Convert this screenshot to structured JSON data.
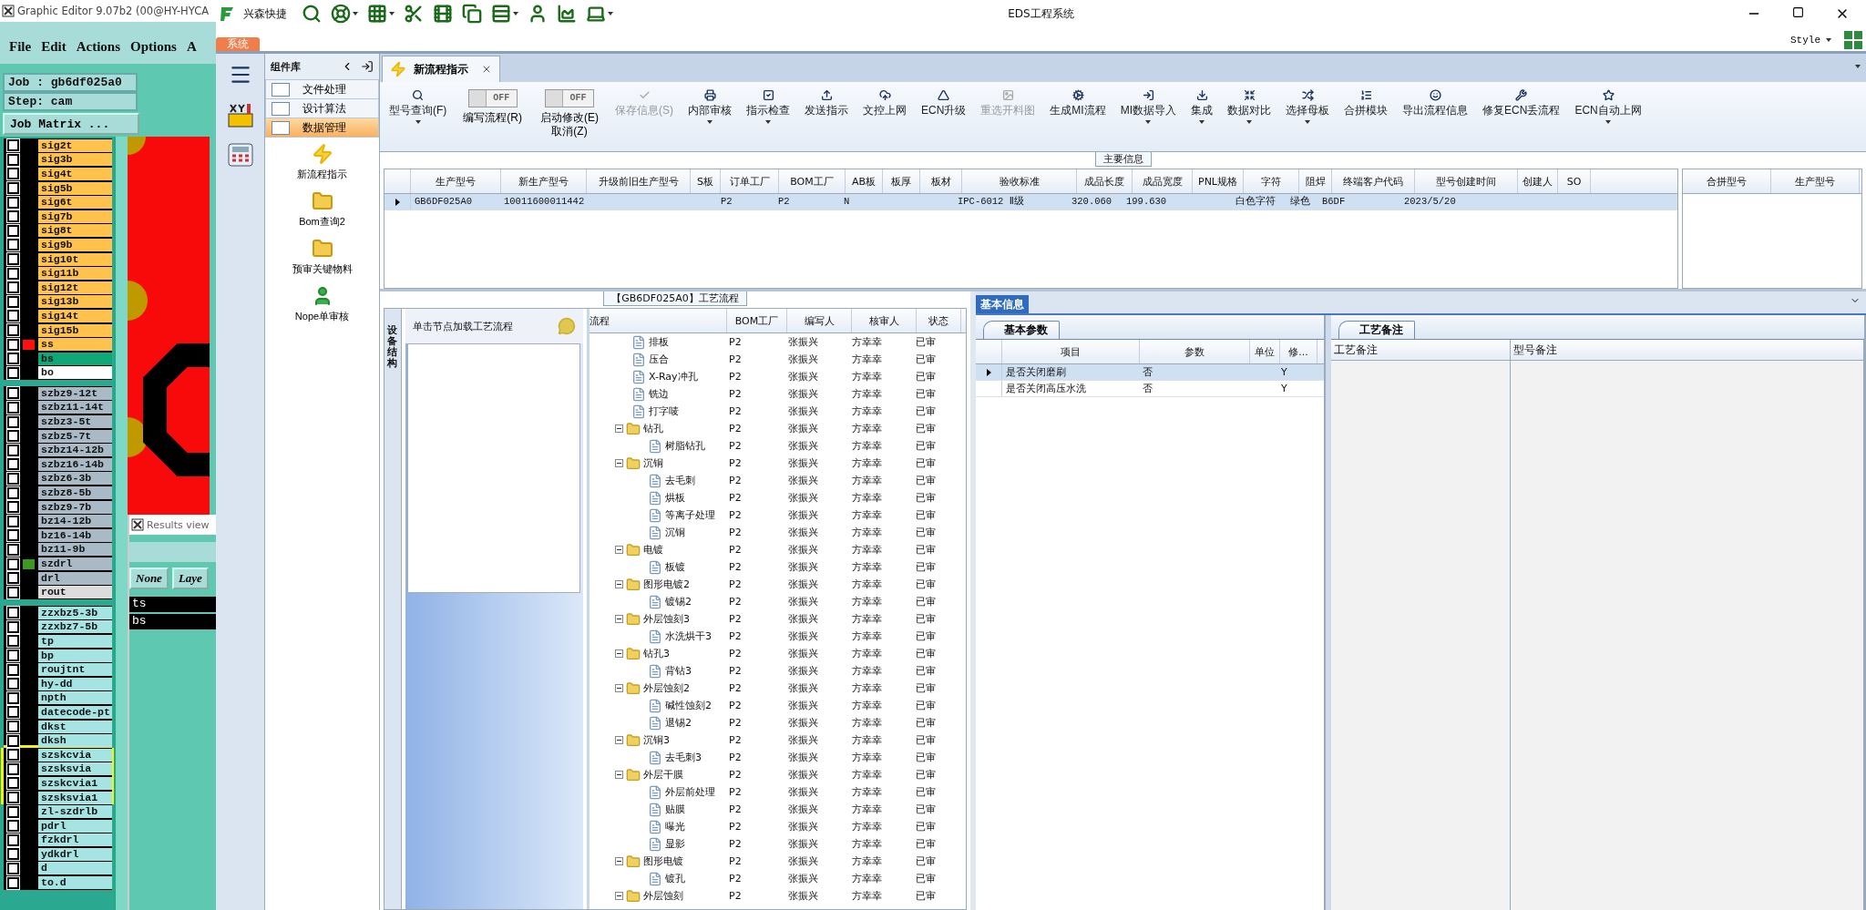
{
  "legacy_window": {
    "title": "Graphic Editor 9.07b2 (00@HY-HYCA",
    "menu": [
      "File",
      "Edit",
      "Actions",
      "Options",
      "A"
    ],
    "job": "Job : gb6df025a0",
    "step": "Step: cam",
    "job_matrix_button": "Job Matrix ...",
    "layer_groups": [
      {
        "separated": false,
        "highlighted": false,
        "layers": [
          {
            "name": "sig2t",
            "color": "#ffc34d"
          },
          {
            "name": "sig3b",
            "color": "#ffc34d"
          },
          {
            "name": "sig4t",
            "color": "#ffc34d"
          },
          {
            "name": "sig5b",
            "color": "#ffc34d"
          },
          {
            "name": "sig6t",
            "color": "#ffc34d"
          },
          {
            "name": "sig7b",
            "color": "#ffc34d"
          },
          {
            "name": "sig8t",
            "color": "#ffc34d"
          },
          {
            "name": "sig9b",
            "color": "#ffc34d"
          },
          {
            "name": "sig10t",
            "color": "#ffc34d"
          },
          {
            "name": "sig11b",
            "color": "#ffc34d"
          },
          {
            "name": "sig12t",
            "color": "#ffc34d"
          },
          {
            "name": "sig13b",
            "color": "#ffc34d"
          },
          {
            "name": "sig14t",
            "color": "#ffc34d"
          },
          {
            "name": "sig15b",
            "color": "#ffc34d"
          },
          {
            "name": "ss",
            "color": "#ffc34d",
            "marker": {
              "color": "#ff1010"
            }
          },
          {
            "name": "bs",
            "color": "#10a878"
          },
          {
            "name": "bo",
            "color": "#ffffff"
          }
        ]
      },
      {
        "separated": true,
        "highlighted": false,
        "layers": [
          {
            "name": "szbz9-12t",
            "color": "#a9b9c6"
          },
          {
            "name": "szbz11-14t",
            "color": "#a9b9c6"
          },
          {
            "name": "szbz3-5t",
            "color": "#a9b9c6"
          },
          {
            "name": "szbz5-7t",
            "color": "#a9b9c6"
          },
          {
            "name": "szbz14-12b",
            "color": "#a9b9c6"
          },
          {
            "name": "szbz16-14b",
            "color": "#a9b9c6"
          },
          {
            "name": "szbz6-3b",
            "color": "#a9b9c6"
          },
          {
            "name": "szbz8-5b",
            "color": "#a9b9c6"
          },
          {
            "name": "szbz9-7b",
            "color": "#a9b9c6"
          },
          {
            "name": "bz14-12b",
            "color": "#a9b9c6"
          },
          {
            "name": "bz16-14b",
            "color": "#a9b9c6"
          },
          {
            "name": "bz11-9b",
            "color": "#a9b9c6"
          },
          {
            "name": "szdrl",
            "color": "#a9b9c6",
            "marker": {
              "color": "#3a9a20"
            }
          },
          {
            "name": "drl",
            "color": "#a9b9c6"
          },
          {
            "name": "rout",
            "color": "#dcdcdc"
          }
        ]
      },
      {
        "separated": true,
        "highlighted": false,
        "layers": [
          {
            "name": "zzxbz5-3b",
            "color": "#a6e3e3"
          },
          {
            "name": "zzxbz7-5b",
            "color": "#a6e3e3"
          },
          {
            "name": "tp",
            "color": "#a6e3e3"
          },
          {
            "name": "bp",
            "color": "#a6e3e3"
          },
          {
            "name": "roujtnt",
            "color": "#a6e3e3"
          },
          {
            "name": "hy-dd",
            "color": "#a6e3e3"
          },
          {
            "name": "npth",
            "color": "#a6e3e3"
          },
          {
            "name": "datecode-pt",
            "color": "#a6e3e3"
          },
          {
            "name": "dkst",
            "color": "#a6e3e3"
          },
          {
            "name": "dksh",
            "color": "#a6e3e3"
          }
        ]
      },
      {
        "separated": false,
        "highlighted": true,
        "layers": [
          {
            "name": "szskcvia",
            "color": "#a6e3e3"
          },
          {
            "name": "szsksvia",
            "color": "#a6e3e3"
          },
          {
            "name": "szskcvia1",
            "color": "#a6e3e3"
          },
          {
            "name": "szsksvia1",
            "color": "#a6e3e3"
          }
        ]
      },
      {
        "separated": false,
        "highlighted": false,
        "layers": [
          {
            "name": "zl-szdrlb",
            "color": "#a6e3e3"
          },
          {
            "name": "pdrl",
            "color": "#a6e3e3"
          },
          {
            "name": "fzkdrl",
            "color": "#a6e3e3"
          },
          {
            "name": "ydkdrl",
            "color": "#a6e3e3"
          },
          {
            "name": "d",
            "color": "#a6e3e3"
          },
          {
            "name": "to.d",
            "color": "#a6e3e3"
          }
        ]
      }
    ],
    "results_view": {
      "title": "Results view",
      "buttons": [
        "None",
        "Laye"
      ],
      "items": [
        "ts",
        "bs"
      ]
    }
  },
  "app": {
    "brand": "兴森快捷",
    "title": "EDS工程系统",
    "quick_toolbar": [
      {
        "has_menu": false
      },
      {
        "has_menu": true
      },
      {
        "has_menu": true
      },
      {
        "has_menu": false
      },
      {
        "has_menu": false
      },
      {
        "has_menu": false
      },
      {
        "has_menu": true
      },
      {
        "has_menu": false
      },
      {
        "has_menu": false
      },
      {
        "has_menu": true
      }
    ],
    "system_tab": "系统",
    "style_menu": "Style",
    "component_library": {
      "title": "组件库",
      "categories": [
        {
          "label": "文件处理",
          "selected": false
        },
        {
          "label": "设计算法",
          "selected": false
        },
        {
          "label": "数据管理",
          "selected": true
        }
      ],
      "modules": [
        "新流程指示",
        "Bom查询2",
        "预审关键物料",
        "Nope单审核"
      ]
    },
    "doc_tab": "新流程指示",
    "ribbon": [
      {
        "kind": "button",
        "label": "型号查询(F)",
        "disabled": false,
        "has_menu": true
      },
      {
        "kind": "toggle",
        "label": "编写流程(R)",
        "on": false,
        "state_label": "OFF"
      },
      {
        "kind": "toggle",
        "label": "启动修改(E)\n取消(Z)",
        "on": false,
        "state_label": "OFF"
      },
      {
        "kind": "button",
        "label": "保存信息(S)",
        "disabled": true,
        "has_menu": false
      },
      {
        "kind": "button",
        "label": "内部审核",
        "disabled": false,
        "has_menu": true
      },
      {
        "kind": "button",
        "label": "指示检查",
        "disabled": false,
        "has_menu": true
      },
      {
        "kind": "button",
        "label": "发送指示",
        "disabled": false,
        "has_menu": false
      },
      {
        "kind": "button",
        "label": "文控上网",
        "disabled": false,
        "has_menu": false
      },
      {
        "kind": "button",
        "label": "ECN升级",
        "disabled": false,
        "has_menu": false
      },
      {
        "kind": "button",
        "label": "重选开料图",
        "disabled": true,
        "has_menu": false
      },
      {
        "kind": "button",
        "label": "生成MI流程",
        "disabled": false,
        "has_menu": false
      },
      {
        "kind": "button",
        "label": "MI数据导入",
        "disabled": false,
        "has_menu": true
      },
      {
        "kind": "button",
        "label": "集成",
        "disabled": false,
        "has_menu": true
      },
      {
        "kind": "button",
        "label": "数据对比",
        "disabled": false,
        "has_menu": true
      },
      {
        "kind": "button",
        "label": "选择母板",
        "disabled": false,
        "has_menu": true
      },
      {
        "kind": "button",
        "label": "合拼模块",
        "disabled": false,
        "has_menu": false
      },
      {
        "kind": "button",
        "label": "导出流程信息",
        "disabled": false,
        "has_menu": false
      },
      {
        "kind": "button",
        "label": "修复ECN丢流程",
        "disabled": false,
        "has_menu": false
      },
      {
        "kind": "button",
        "label": "ECN自动上网",
        "disabled": false,
        "has_menu": true
      }
    ],
    "main_info": {
      "title": "主要信息",
      "columns": [
        "生产型号",
        "新生产型号",
        "升级前旧生产型号",
        "S板",
        "订单工厂",
        "BOM工厂",
        "AB板",
        "板厚",
        "板材",
        "验收标准",
        "成品长度",
        "成品宽度",
        "PNL规格",
        "字符",
        "阻焊",
        "终端客户代码",
        "型号创建时间",
        "创建人",
        "SO"
      ],
      "rows": [
        {
          "selected": true,
          "cells": [
            "GB6DF025A0",
            "10011600011442",
            "",
            "",
            "P2",
            "P2",
            "N",
            "",
            "",
            "IPC-6012 Ⅱ级",
            "320.060",
            "199.630",
            "",
            "白色字符",
            "绿色",
            "B6DF",
            "2023/5/20",
            "",
            ""
          ]
        }
      ],
      "side_columns": [
        "合拼型号",
        "生产型号"
      ]
    },
    "process": {
      "title": "【GB6DF025A0】工艺流程",
      "side_tab": "设备结构",
      "hint": "单击节点加载工艺流程",
      "columns": [
        "流程",
        "BOM工厂",
        "编写人",
        "核审人",
        "状态"
      ],
      "tree": [
        {
          "kind": "file",
          "name": "排板",
          "cells": [
            "P2",
            "张振兴",
            "方幸幸",
            "已审"
          ]
        },
        {
          "kind": "file",
          "name": "压合",
          "cells": [
            "P2",
            "张振兴",
            "方幸幸",
            "已审"
          ]
        },
        {
          "kind": "file",
          "name": "X-Ray冲孔",
          "cells": [
            "P2",
            "张振兴",
            "方幸幸",
            "已审"
          ]
        },
        {
          "kind": "file",
          "name": "铣边",
          "cells": [
            "P2",
            "张振兴",
            "方幸幸",
            "已审"
          ]
        },
        {
          "kind": "file",
          "name": "打字唛",
          "cells": [
            "P2",
            "张振兴",
            "方幸幸",
            "已审"
          ]
        },
        {
          "kind": "folder",
          "name": "钻孔",
          "cells": [
            "P2",
            "张振兴",
            "方幸幸",
            "已审"
          ],
          "children": [
            {
              "kind": "file",
              "name": "树脂钻孔",
              "cells": [
                "P2",
                "张振兴",
                "方幸幸",
                "已审"
              ]
            }
          ]
        },
        {
          "kind": "folder",
          "name": "沉铜",
          "cells": [
            "P2",
            "张振兴",
            "方幸幸",
            "已审"
          ],
          "children": [
            {
              "kind": "file",
              "name": "去毛刺",
              "cells": [
                "P2",
                "张振兴",
                "方幸幸",
                "已审"
              ]
            },
            {
              "kind": "file",
              "name": "烘板",
              "cells": [
                "P2",
                "张振兴",
                "方幸幸",
                "已审"
              ]
            },
            {
              "kind": "file",
              "name": "等离子处理",
              "cells": [
                "P2",
                "张振兴",
                "方幸幸",
                "已审"
              ]
            },
            {
              "kind": "file",
              "name": "沉铜",
              "cells": [
                "P2",
                "张振兴",
                "方幸幸",
                "已审"
              ]
            }
          ]
        },
        {
          "kind": "folder",
          "name": "电镀",
          "cells": [
            "P2",
            "张振兴",
            "方幸幸",
            "已审"
          ],
          "children": [
            {
              "kind": "file",
              "name": "板镀",
              "cells": [
                "P2",
                "张振兴",
                "方幸幸",
                "已审"
              ]
            }
          ]
        },
        {
          "kind": "folder",
          "name": "图形电镀2",
          "cells": [
            "P2",
            "张振兴",
            "方幸幸",
            "已审"
          ],
          "children": [
            {
              "kind": "file",
              "name": "镀锡2",
              "cells": [
                "P2",
                "张振兴",
                "方幸幸",
                "已审"
              ]
            }
          ]
        },
        {
          "kind": "folder",
          "name": "外层蚀刻3",
          "cells": [
            "P2",
            "张振兴",
            "方幸幸",
            "已审"
          ],
          "children": [
            {
              "kind": "file",
              "name": "水洗烘干3",
              "cells": [
                "P2",
                "张振兴",
                "方幸幸",
                "已审"
              ]
            }
          ]
        },
        {
          "kind": "folder",
          "name": "钻孔3",
          "cells": [
            "P2",
            "张振兴",
            "方幸幸",
            "已审"
          ],
          "children": [
            {
              "kind": "file",
              "name": "背钻3",
              "cells": [
                "P2",
                "张振兴",
                "方幸幸",
                "已审"
              ]
            }
          ]
        },
        {
          "kind": "folder",
          "name": "外层蚀刻2",
          "cells": [
            "P2",
            "张振兴",
            "方幸幸",
            "已审"
          ],
          "children": [
            {
              "kind": "file",
              "name": "碱性蚀刻2",
              "cells": [
                "P2",
                "张振兴",
                "方幸幸",
                "已审"
              ]
            },
            {
              "kind": "file",
              "name": "退锡2",
              "cells": [
                "P2",
                "张振兴",
                "方幸幸",
                "已审"
              ]
            }
          ]
        },
        {
          "kind": "folder",
          "name": "沉铜3",
          "cells": [
            "P2",
            "张振兴",
            "方幸幸",
            "已审"
          ],
          "children": [
            {
              "kind": "file",
              "name": "去毛刺3",
              "cells": [
                "P2",
                "张振兴",
                "方幸幸",
                "已审"
              ]
            }
          ]
        },
        {
          "kind": "folder",
          "name": "外层干膜",
          "cells": [
            "P2",
            "张振兴",
            "方幸幸",
            "已审"
          ],
          "children": [
            {
              "kind": "file",
              "name": "外层前处理",
              "cells": [
                "P2",
                "张振兴",
                "方幸幸",
                "已审"
              ]
            },
            {
              "kind": "file",
              "name": "贴膜",
              "cells": [
                "P2",
                "张振兴",
                "方幸幸",
                "已审"
              ]
            },
            {
              "kind": "file",
              "name": "曝光",
              "cells": [
                "P2",
                "张振兴",
                "方幸幸",
                "已审"
              ]
            },
            {
              "kind": "file",
              "name": "显影",
              "cells": [
                "P2",
                "张振兴",
                "方幸幸",
                "已审"
              ]
            }
          ]
        },
        {
          "kind": "folder",
          "name": "图形电镀",
          "cells": [
            "P2",
            "张振兴",
            "方幸幸",
            "已审"
          ],
          "children": [
            {
              "kind": "file",
              "name": "镀孔",
              "cells": [
                "P2",
                "张振兴",
                "方幸幸",
                "已审"
              ]
            }
          ]
        },
        {
          "kind": "folder",
          "name": "外层蚀刻",
          "cells": [
            "P2",
            "张振兴",
            "方幸幸",
            "已审"
          ]
        }
      ]
    },
    "basic_info": {
      "title": "基本信息",
      "params_tab": "基本参数",
      "columns": [
        "项目",
        "参数",
        "单位",
        "修..."
      ],
      "rows": [
        {
          "selected": true,
          "cells": [
            "是否关闭磨刷",
            "否",
            "",
            "Y"
          ]
        },
        {
          "selected": false,
          "cells": [
            "是否关闭高压水洗",
            "否",
            "",
            "Y"
          ]
        }
      ],
      "notes_tab": "工艺备注",
      "notes_columns": [
        "工艺备注",
        "型号备注"
      ]
    }
  }
}
